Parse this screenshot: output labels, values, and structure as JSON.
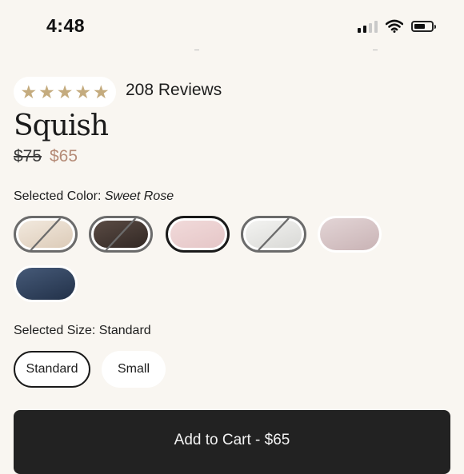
{
  "status_bar": {
    "time": "4:48",
    "icons": [
      "cellular-signal-icon",
      "wifi-icon",
      "battery-icon"
    ]
  },
  "rating": {
    "stars": 5,
    "star_glyph": "★",
    "star_color": "#c4ab7e",
    "reviews_label": "208 Reviews"
  },
  "product": {
    "title": "Squish",
    "price_original": "$75",
    "price_sale": "$65",
    "sale_price_color": "#b58b77"
  },
  "color_selector": {
    "label": "Selected Color:",
    "value": "Sweet Rose",
    "swatches": [
      {
        "state": "unavailable",
        "color": "#e8dccd"
      },
      {
        "state": "unavailable",
        "color": "#463b36"
      },
      {
        "state": "selected",
        "color": "#ecd2d2"
      },
      {
        "state": "unavailable",
        "color": "#e7e7e4"
      },
      {
        "state": "available",
        "color": "#d5c3c4"
      },
      {
        "state": "available",
        "color": "#33455f"
      }
    ]
  },
  "size_selector": {
    "label": "Selected Size:",
    "value": "Standard",
    "options": [
      {
        "label": "Standard",
        "selected": true
      },
      {
        "label": "Small",
        "selected": false
      }
    ]
  },
  "cart": {
    "button_label": "Add to Cart - $65",
    "button_color": "#222222"
  }
}
